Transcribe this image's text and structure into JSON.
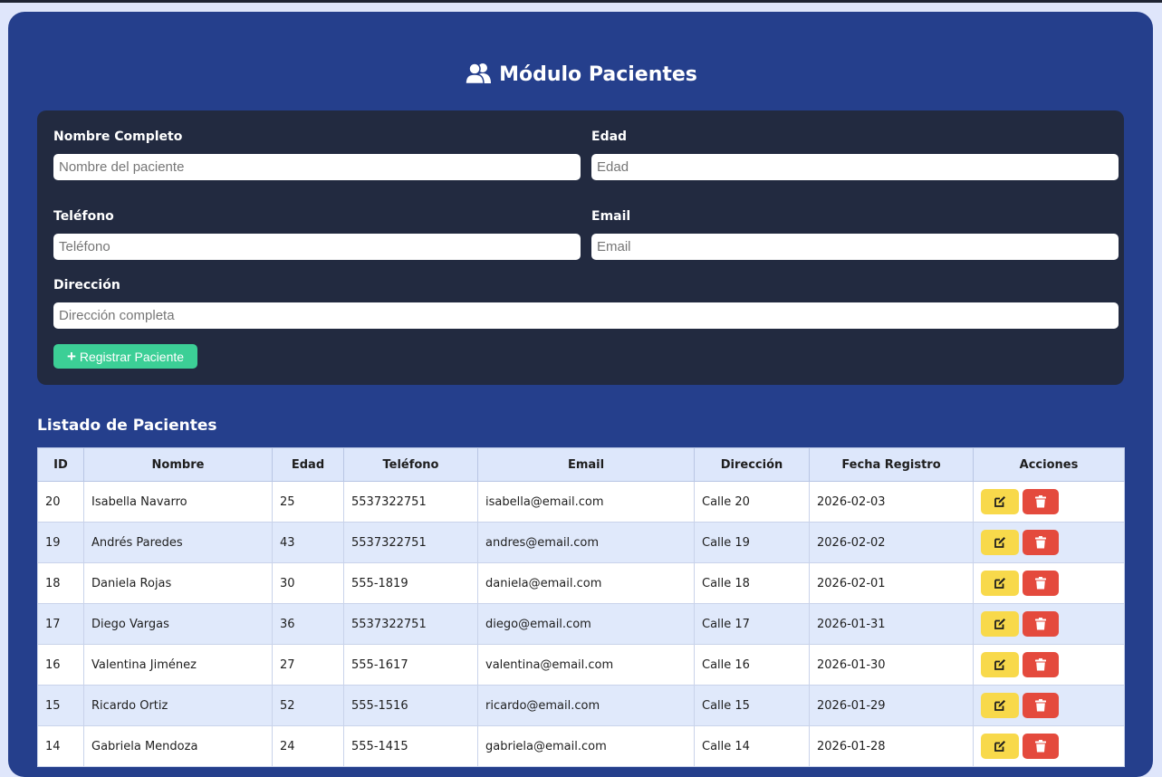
{
  "header": {
    "title": "Módulo Pacientes",
    "icon": "users-icon"
  },
  "form": {
    "name_label": "Nombre Completo",
    "name_placeholder": "Nombre del paciente",
    "age_label": "Edad",
    "age_placeholder": "Edad",
    "phone_label": "Teléfono",
    "phone_placeholder": "Teléfono",
    "email_label": "Email",
    "email_placeholder": "Email",
    "address_label": "Dirección",
    "address_placeholder": "Dirección completa",
    "submit_label": "Registrar Paciente"
  },
  "list": {
    "title": "Listado de Pacientes",
    "columns": [
      "ID",
      "Nombre",
      "Edad",
      "Teléfono",
      "Email",
      "Dirección",
      "Fecha Registro",
      "Acciones"
    ],
    "rows": [
      {
        "id": "20",
        "name": "Isabella Navarro",
        "age": "25",
        "phone": "5537322751",
        "email": "isabella@email.com",
        "address": "Calle 20",
        "date": "2026-02-03"
      },
      {
        "id": "19",
        "name": "Andrés Paredes",
        "age": "43",
        "phone": "5537322751",
        "email": "andres@email.com",
        "address": "Calle 19",
        "date": "2026-02-02"
      },
      {
        "id": "18",
        "name": "Daniela Rojas",
        "age": "30",
        "phone": "555-1819",
        "email": "daniela@email.com",
        "address": "Calle 18",
        "date": "2026-02-01"
      },
      {
        "id": "17",
        "name": "Diego Vargas",
        "age": "36",
        "phone": "5537322751",
        "email": "diego@email.com",
        "address": "Calle 17",
        "date": "2026-01-31"
      },
      {
        "id": "16",
        "name": "Valentina Jiménez",
        "age": "27",
        "phone": "555-1617",
        "email": "valentina@email.com",
        "address": "Calle 16",
        "date": "2026-01-30"
      },
      {
        "id": "15",
        "name": "Ricardo Ortiz",
        "age": "52",
        "phone": "555-1516",
        "email": "ricardo@email.com",
        "address": "Calle 15",
        "date": "2026-01-29"
      },
      {
        "id": "14",
        "name": "Gabriela Mendoza",
        "age": "24",
        "phone": "555-1415",
        "email": "gabriela@email.com",
        "address": "Calle 14",
        "date": "2026-01-28"
      }
    ],
    "row_actions": {
      "edit_icon": "edit-icon",
      "delete_icon": "trash-icon"
    }
  },
  "colors": {
    "page_background": "#dfe6fb",
    "panel_background": "#253f8c",
    "form_background": "#222a40",
    "primary_button": "#3ccf96",
    "edit_button": "#f8d94b",
    "delete_button": "#e44a3d",
    "header_row": "#dde7fb"
  }
}
